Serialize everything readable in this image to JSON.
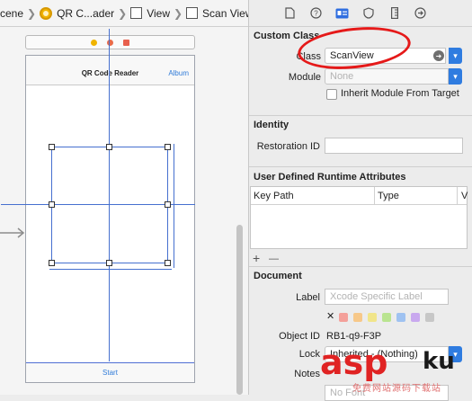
{
  "breadcrumb": {
    "items": [
      "cene",
      "QR C...ader",
      "View",
      "Scan View"
    ]
  },
  "canvas": {
    "nav_title": "QR Code Reader",
    "nav_right": "Album",
    "toolbar_button": "Start",
    "accent_color": "#4670cf"
  },
  "inspector": {
    "custom_class": {
      "title": "Custom Class",
      "class_label": "Class",
      "class_value": "ScanView",
      "module_label": "Module",
      "module_placeholder": "None",
      "inherit_label": "Inherit Module From Target"
    },
    "identity": {
      "title": "Identity",
      "restoration_label": "Restoration ID"
    },
    "runtime_attributes": {
      "title": "User Defined Runtime Attributes",
      "columns": [
        "Key Path",
        "Type",
        "V"
      ],
      "add": "+",
      "remove": "—"
    },
    "document": {
      "title": "Document",
      "label_label": "Label",
      "label_placeholder": "Xcode Specific Label",
      "clear_mark": "✕",
      "label_colors": [
        "#f4a09a",
        "#f7c889",
        "#f1e58a",
        "#b9e490",
        "#9fc2f1",
        "#c9a9ef",
        "#c7c7c7"
      ],
      "object_id_label": "Object ID",
      "object_id_value": "RB1-q9-F3P",
      "lock_label": "Lock",
      "lock_value": "Inherited - (Nothing)",
      "notes_label": "Notes",
      "font_placeholder": "No Font"
    }
  },
  "watermark": {
    "main": "asp",
    "suffix": "ku",
    "sub": "免费网站源码下载站"
  }
}
